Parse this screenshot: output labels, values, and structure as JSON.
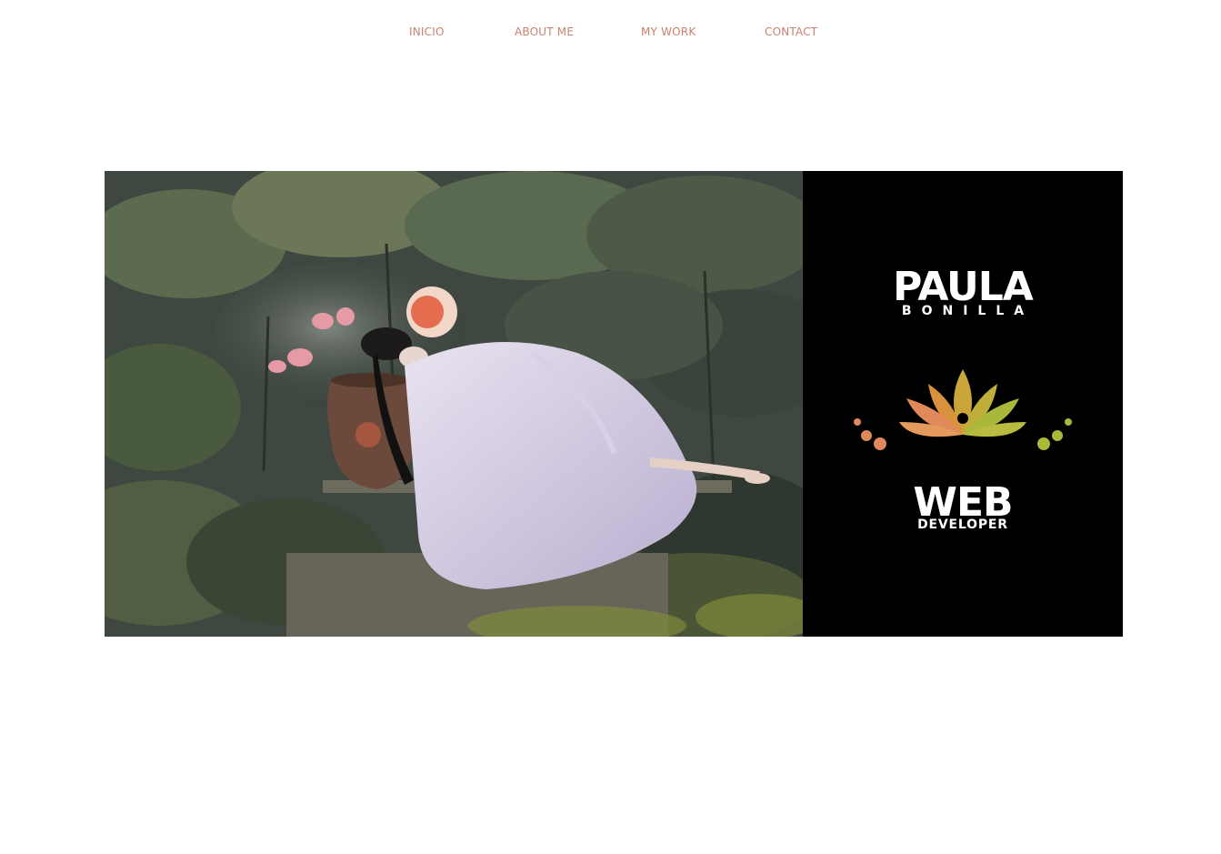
{
  "nav": {
    "items": [
      {
        "label": "INICIO"
      },
      {
        "label": "ABOUT ME"
      },
      {
        "label": "MY WORK"
      },
      {
        "label": "CONTACT"
      }
    ]
  },
  "hero": {
    "brand": {
      "name": "PAULA",
      "surname": "BONILLA",
      "role_main": "WEB",
      "role_sub": "DEVELOPER"
    },
    "logo_icon": "lotus-icon",
    "photo_icon": "hero-photo"
  },
  "colors": {
    "nav_text": "#c9826f",
    "panel_bg": "#000000",
    "lotus_orange": "#e0895a",
    "lotus_gold": "#c9a53a",
    "lotus_green": "#a9b83a"
  }
}
